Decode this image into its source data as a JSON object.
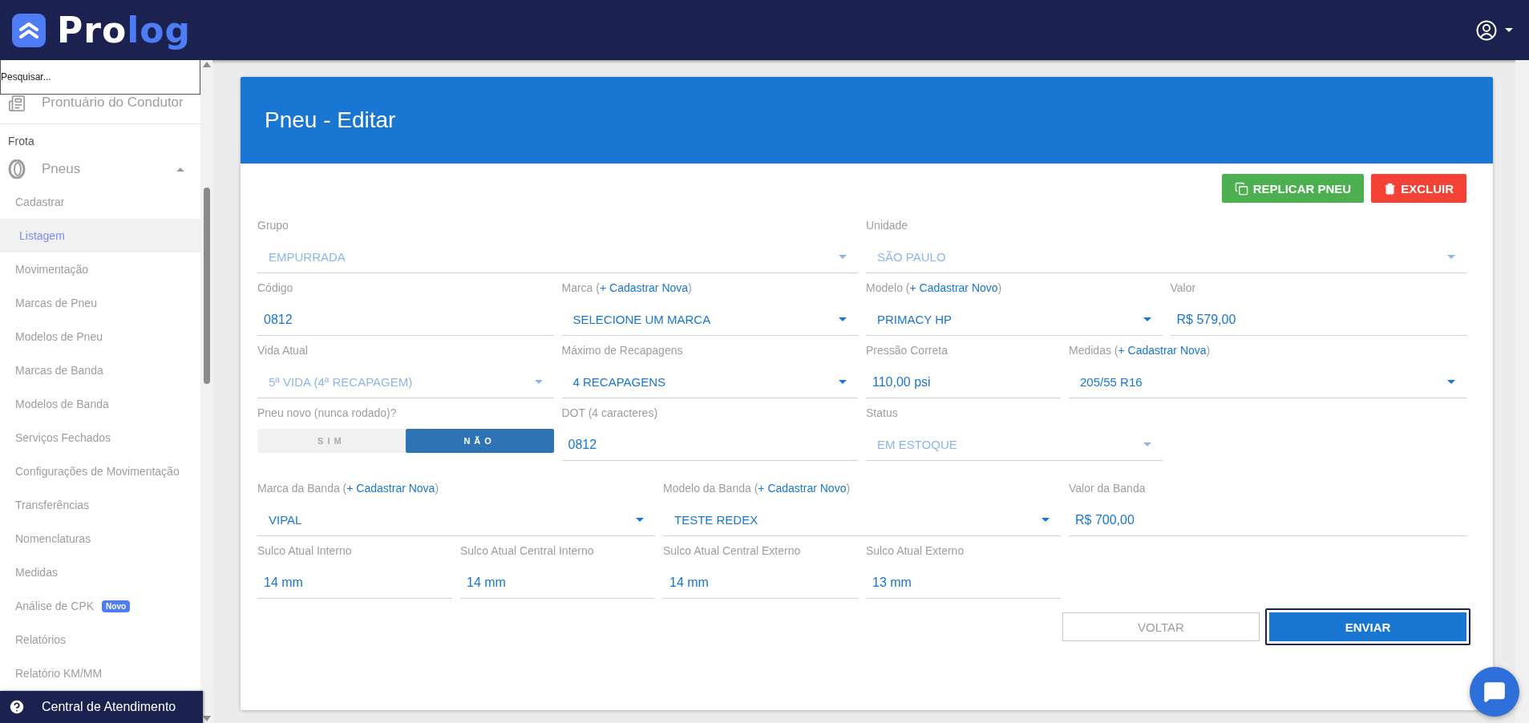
{
  "header": {
    "logo_text": [
      "Pro",
      "log"
    ]
  },
  "sidebar": {
    "search": {
      "placeholder": "Pesquisar..."
    },
    "items": [
      {
        "kind": "menu",
        "label": "Prontuário do Condutor"
      },
      {
        "kind": "section",
        "label": "Frota"
      },
      {
        "kind": "menu",
        "label": "Pneus",
        "expanded": true,
        "children": [
          {
            "label": "Cadastrar",
            "selected": false
          },
          {
            "label": "Listagem",
            "selected": true
          },
          {
            "label": "Movimentação",
            "selected": false
          },
          {
            "label": "Marcas de Pneu",
            "selected": false
          },
          {
            "label": "Modelos de Pneu",
            "selected": false
          },
          {
            "label": "Marcas de Banda",
            "selected": false
          },
          {
            "label": "Modelos de Banda",
            "selected": false
          },
          {
            "label": "Serviços Fechados",
            "selected": false
          },
          {
            "label": "Configurações de Movimentação",
            "selected": false
          },
          {
            "label": "Transferências",
            "selected": false
          },
          {
            "label": "Nomenclaturas",
            "selected": false
          },
          {
            "label": "Medidas",
            "selected": false
          },
          {
            "label": "Análise de CPK",
            "selected": false,
            "badge": "Novo"
          },
          {
            "label": "Relatórios",
            "selected": false
          },
          {
            "label": "Relatório KM/MM",
            "selected": false
          }
        ]
      }
    ],
    "footer": {
      "label": "Central de Atendimento"
    }
  },
  "card": {
    "title": "Pneu - Editar",
    "actions": [
      {
        "label": "REPLICAR PNEU",
        "kind": "replicate"
      },
      {
        "label": "EXCLUIR",
        "kind": "delete"
      }
    ],
    "form_lines": [
      {
        "fields": [
          {
            "kind": "select",
            "label": "Grupo",
            "value": "EMPURRADA",
            "disabled": true
          },
          {
            "kind": "select",
            "label": "Unidade",
            "value": "SÃO PAULO",
            "disabled": true
          }
        ]
      },
      {
        "fields": [
          {
            "kind": "text",
            "label": "Código",
            "value": "0812",
            "disabled": false
          },
          {
            "kind": "select",
            "label": "Marca (",
            "link": "+ Cadastrar Nova",
            "label_end": ")",
            "value": "SELECIONE UM MARCA",
            "disabled": false
          },
          {
            "kind": "select",
            "label": "Modelo (",
            "link": "+ Cadastrar Novo",
            "label_end": ")",
            "value": "PRIMACY HP",
            "disabled": false
          },
          {
            "kind": "text",
            "label": "Valor",
            "value": "R$ 579,00",
            "disabled": false
          }
        ]
      },
      {
        "fields": [
          {
            "kind": "select",
            "label": "Vida Atual",
            "value": "5ª VIDA (4ª RECAPAGEM)",
            "disabled": true
          },
          {
            "kind": "select",
            "label": "Máximo de Recapagens",
            "value": "4 RECAPAGENS",
            "disabled": false
          },
          {
            "kind": "text",
            "label": "Pressão Correta",
            "value": "110,00 psi",
            "disabled": false
          },
          {
            "kind": "select",
            "label": "Medidas (",
            "link": "+ Cadastrar Nova",
            "label_end": ")",
            "value": "205/55 R16",
            "disabled": false
          }
        ]
      },
      {
        "fields": [
          {
            "kind": "toggle",
            "label": "Pneu novo (nunca rodado)?",
            "options": [
              {
                "label": "SIM",
                "selected": false
              },
              {
                "label": "NÃO",
                "selected": true
              }
            ]
          },
          {
            "kind": "text",
            "label": "DOT (4 caracteres)",
            "value": "0812",
            "disabled": false
          },
          {
            "kind": "select",
            "label": "Status",
            "value": "EM ESTOQUE",
            "disabled": true
          }
        ]
      },
      {
        "fields": [
          {
            "kind": "select",
            "label": "Marca da Banda (",
            "link": "+ Cadastrar Nova",
            "label_end": ")",
            "value": "VIPAL",
            "disabled": false
          },
          {
            "kind": "select",
            "label": "Modelo da Banda (",
            "link": "+ Cadastrar Novo",
            "label_end": ")",
            "value": "TESTE REDEX",
            "disabled": false
          },
          {
            "kind": "text",
            "label": "Valor da Banda",
            "value": "R$ 700,00",
            "disabled": false
          }
        ]
      },
      {
        "fields": [
          {
            "kind": "text",
            "label": "Sulco Atual Interno",
            "value": "14 mm",
            "disabled": false
          },
          {
            "kind": "text",
            "label": "Sulco Atual Central Interno",
            "value": "14 mm",
            "disabled": false
          },
          {
            "kind": "text",
            "label": "Sulco Atual Central Externo",
            "value": "14 mm",
            "disabled": false
          },
          {
            "kind": "text",
            "label": "Sulco Atual Externo",
            "value": "13 mm",
            "disabled": false
          }
        ]
      }
    ],
    "buttons": [
      {
        "label": "VOLTAR",
        "kind": "secondary",
        "focused": false
      },
      {
        "label": "ENVIAR",
        "kind": "primary",
        "focused": true
      }
    ]
  }
}
